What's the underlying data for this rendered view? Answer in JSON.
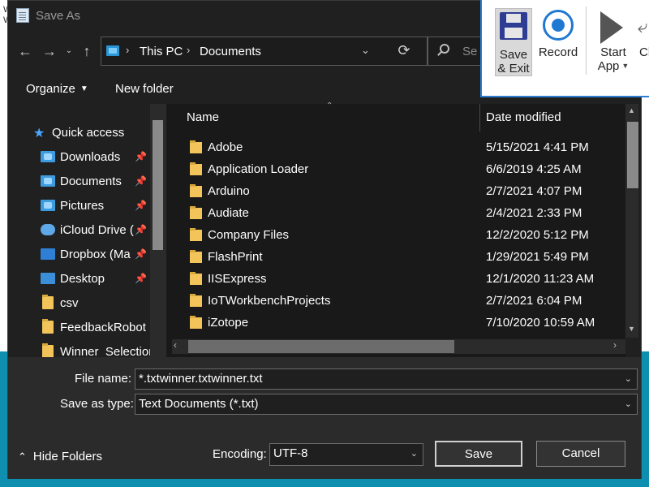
{
  "dialog": {
    "title": "Save As"
  },
  "background": {
    "left_text": "W\nW"
  },
  "address": {
    "segments": [
      "This PC",
      "Documents"
    ],
    "search_placeholder": "Se"
  },
  "toolbar": {
    "organize_label": "Organize",
    "new_folder_label": "New folder"
  },
  "navpane": {
    "quick_access": "Quick access",
    "items": [
      {
        "label": "Downloads",
        "icon": "downloads-icon",
        "pinned": true
      },
      {
        "label": "Documents",
        "icon": "documents-icon",
        "pinned": true
      },
      {
        "label": "Pictures",
        "icon": "pictures-icon",
        "pinned": true
      },
      {
        "label": "iCloud Drive (",
        "icon": "icloud-icon",
        "pinned": true
      },
      {
        "label": "Dropbox (Ma",
        "icon": "dropbox-icon",
        "pinned": true
      },
      {
        "label": "Desktop",
        "icon": "desktop-icon",
        "pinned": true
      },
      {
        "label": "csv",
        "icon": "folder-icon",
        "pinned": false
      },
      {
        "label": "FeedbackRobot",
        "icon": "folder-icon",
        "pinned": false
      },
      {
        "label": "Winner_Selection",
        "icon": "folder-icon",
        "pinned": false
      }
    ]
  },
  "filelist": {
    "columns": {
      "name": "Name",
      "date": "Date modified"
    },
    "rows": [
      {
        "name": "Adobe",
        "date": "5/15/2021 4:41 PM"
      },
      {
        "name": "Application Loader",
        "date": "6/6/2019 4:25 AM"
      },
      {
        "name": "Arduino",
        "date": "2/7/2021 4:07 PM"
      },
      {
        "name": "Audiate",
        "date": "2/4/2021 2:33 PM"
      },
      {
        "name": "Company Files",
        "date": "12/2/2020 5:12 PM"
      },
      {
        "name": "FlashPrint",
        "date": "1/29/2021 5:49 PM"
      },
      {
        "name": "IISExpress",
        "date": "12/1/2020 11:23 AM"
      },
      {
        "name": "IoTWorkbenchProjects",
        "date": "2/7/2021 6:04 PM"
      },
      {
        "name": "iZotope",
        "date": "7/10/2020 10:59 AM"
      }
    ]
  },
  "form": {
    "file_name_label": "File name:",
    "file_name_value": "*.txtwinner.txtwinner.txt",
    "save_type_label": "Save as type:",
    "save_type_value": "Text Documents (*.txt)",
    "encoding_label": "Encoding:",
    "encoding_value": "UTF-8",
    "save_label": "Save",
    "cancel_label": "Cancel",
    "hide_folders_label": "Hide Folders"
  },
  "recorder": {
    "save_exit_label_1": "Save",
    "save_exit_label_2": "& Exit",
    "record_label": "Record",
    "start_label_1": "Start",
    "start_label_2": "App",
    "cl_label": "Cl"
  },
  "colors": {
    "dialog_bg": "#202020",
    "accent": "#1f78d1",
    "folder": "#f2c45a"
  }
}
